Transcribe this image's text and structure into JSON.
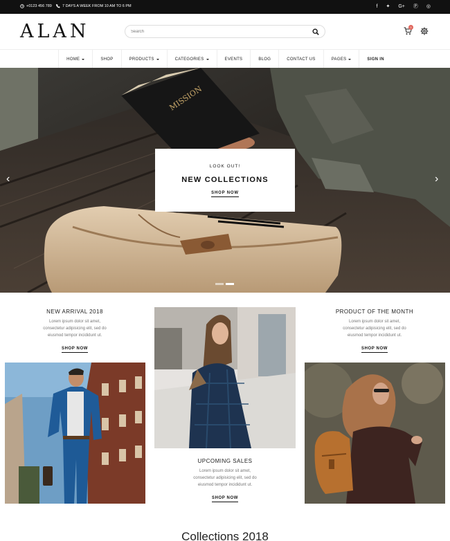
{
  "topbar": {
    "phone": "+0123 456 789",
    "hours": "7 DAYS A WEEK FROM 10 AM TO 6 PM",
    "social_icons": [
      "facebook-icon",
      "twitter-icon",
      "google-plus-icon",
      "pinterest-icon",
      "instagram-icon"
    ],
    "social_glyphs": [
      "f",
      "✦",
      "G+",
      "Ⓟ",
      "◎"
    ]
  },
  "header": {
    "logo": "ALAN",
    "search_placeholder": "Search",
    "cart_count": "0"
  },
  "nav": {
    "items": [
      {
        "label": "HOME",
        "dropdown": true
      },
      {
        "label": "SHOP",
        "dropdown": false
      },
      {
        "label": "PRODUCTS",
        "dropdown": true
      },
      {
        "label": "CATEGORIES",
        "dropdown": true
      },
      {
        "label": "EVENTS",
        "dropdown": false
      },
      {
        "label": "BLOG",
        "dropdown": false
      },
      {
        "label": "CONTACT US",
        "dropdown": false
      },
      {
        "label": "PAGES",
        "dropdown": true
      },
      {
        "label": "SIGN IN",
        "dropdown": false
      }
    ]
  },
  "hero": {
    "kicker": "LOOK OUT!",
    "headline": "NEW COLLECTIONS",
    "cta": "SHOP NOW",
    "book_title": "MISSION",
    "prev_glyph": "‹",
    "next_glyph": "›"
  },
  "promos": {
    "new_arrival": {
      "title": "NEW ARRIVAL 2018",
      "desc_lines": [
        "Lorem ipsum dolor sit amet,",
        "consectetur adipisicing elit, sed do",
        "eiusmod tempor incididunt ut."
      ],
      "link": "SHOP NOW"
    },
    "product_of_month": {
      "title": "PRODUCT OF THE MONTH",
      "desc_lines": [
        "Lorem ipsum dolor sit amet,",
        "consectetur adipisicing elit, sed do",
        "eiusmod tempor incididunt ut."
      ],
      "link": "SHOP NOW"
    },
    "upcoming_sales": {
      "title": "UPCOMING SALES",
      "desc_lines": [
        "Lorem ipsum dolor sit amet,",
        "consectetur adipisicing elit, sed do",
        "eiusmod tempor incididunt ut."
      ],
      "link": "SHOP NOW"
    }
  },
  "collections_title": "Collections 2018",
  "colors": {
    "topbar_bg": "#111111",
    "badge": "#e0665c",
    "text": "#222222",
    "muted": "#777777"
  }
}
